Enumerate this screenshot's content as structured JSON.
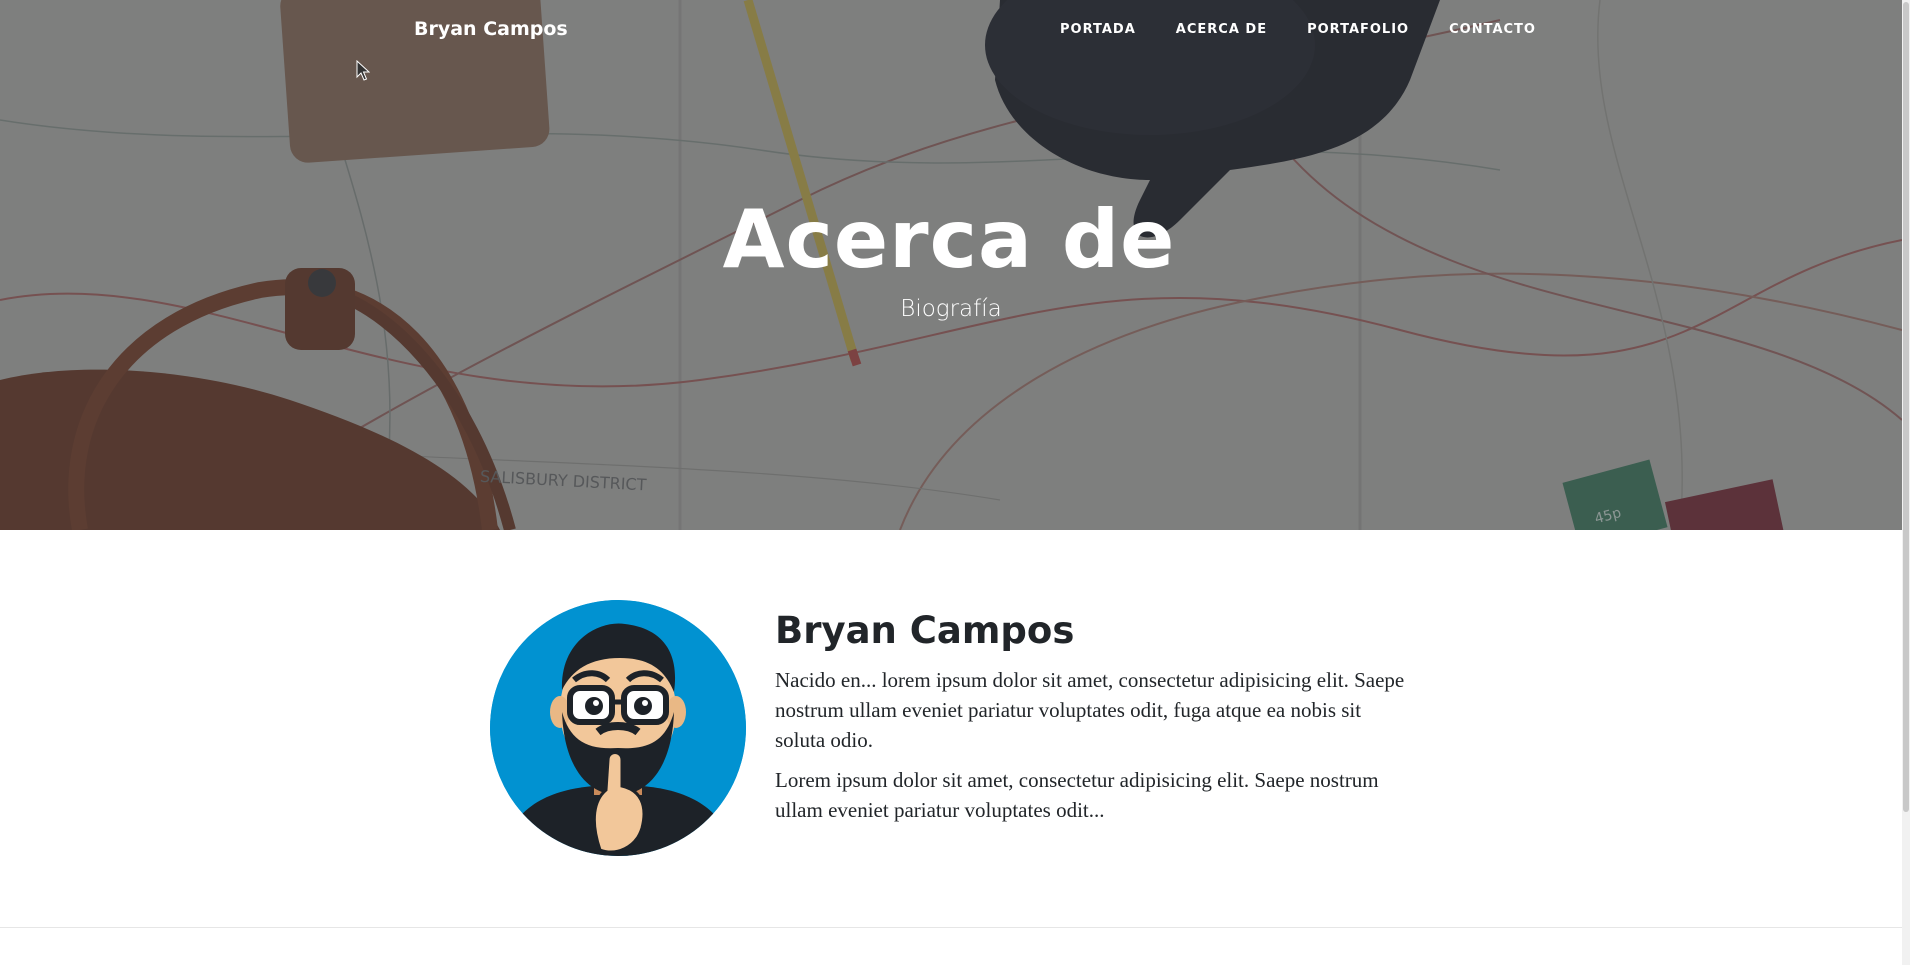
{
  "navbar": {
    "brand": "Bryan Campos",
    "links": [
      "PORTADA",
      "ACERCA DE",
      "PORTAFOLIO",
      "CONTACTO"
    ]
  },
  "hero": {
    "title": "Acerca de",
    "subtitle": "Biografía",
    "map_text": [
      "SALISBURY DISTRICT",
      "45p"
    ]
  },
  "about": {
    "name": "Bryan Campos",
    "paragraphs": [
      "Nacido en... lorem ipsum dolor sit amet, consectetur adipisicing elit. Saepe nostrum ullam eveniet pariatur voluptates odit, fuga atque ea nobis sit soluta odio.",
      "Lorem ipsum dolor sit amet, consectetur adipisicing elit. Saepe nostrum ullam eveniet pariatur voluptates odit..."
    ]
  },
  "icons": {
    "cursor": "mouse-pointer-icon",
    "avatar": "bearded-man-avatar"
  },
  "colors": {
    "avatar_background": "#0192d1",
    "text": "#212529",
    "hero_overlay": "#3c4048"
  }
}
